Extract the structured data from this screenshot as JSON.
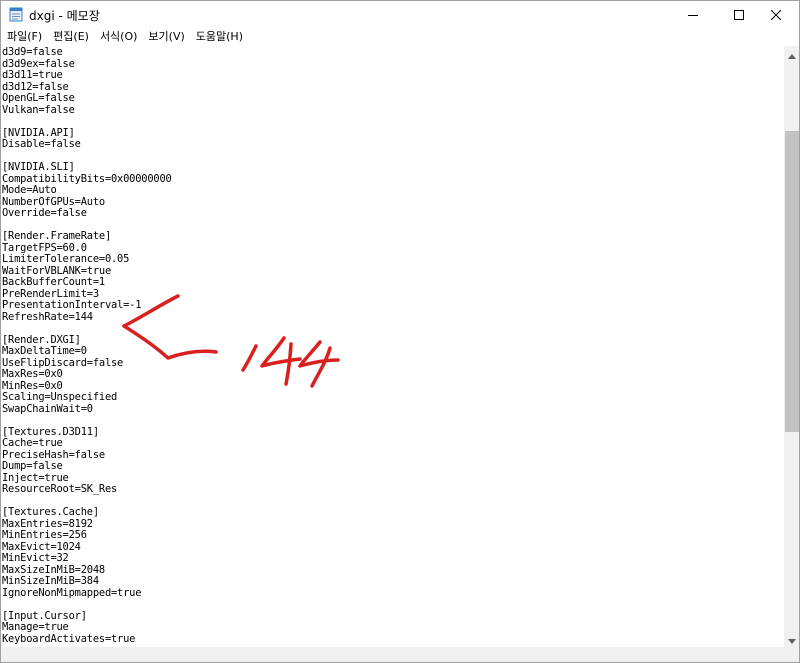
{
  "window": {
    "title": "dxgi - 메모장",
    "icons": {
      "app": "notepad-icon",
      "minimize": "minimize-icon",
      "maximize": "maximize-icon",
      "close": "close-icon"
    }
  },
  "menu": [
    {
      "label": "파일(F)"
    },
    {
      "label": "편집(E)"
    },
    {
      "label": "서식(O)"
    },
    {
      "label": "보기(V)"
    },
    {
      "label": "도움말(H)"
    }
  ],
  "editor": {
    "lines": [
      "d3d9=false",
      "d3d9ex=false",
      "d3d11=true",
      "d3d12=false",
      "OpenGL=false",
      "Vulkan=false",
      "",
      "[NVIDIA.API]",
      "Disable=false",
      "",
      "[NVIDIA.SLI]",
      "CompatibilityBits=0x00000000",
      "Mode=Auto",
      "NumberOfGPUs=Auto",
      "Override=false",
      "",
      "[Render.FrameRate]",
      "TargetFPS=60.0",
      "LimiterTolerance=0.05",
      "WaitForVBLANK=true",
      "BackBufferCount=1",
      "PreRenderLimit=3",
      "PresentationInterval=-1",
      "RefreshRate=144",
      "",
      "[Render.DXGI]",
      "MaxDeltaTime=0",
      "UseFlipDiscard=false",
      "MaxRes=0x0",
      "MinRes=0x0",
      "Scaling=Unspecified",
      "SwapChainWait=0",
      "",
      "[Textures.D3D11]",
      "Cache=true",
      "PreciseHash=false",
      "Dump=false",
      "Inject=true",
      "ResourceRoot=SK_Res",
      "",
      "[Textures.Cache]",
      "MaxEntries=8192",
      "MinEntries=256",
      "MaxEvict=1024",
      "MinEvict=32",
      "MaxSizeInMiB=2048",
      "MinSizeInMiB=384",
      "IgnoreNonMipmapped=true",
      "",
      "[Input.Cursor]",
      "Manage=true",
      "KeyboardActivates=true"
    ]
  },
  "scrollbar": {
    "vertical_thumb_start": 0.12,
    "vertical_thumb_end": 0.65
  },
  "annotation": {
    "handwritten_text": "144",
    "color": "#d9201f"
  }
}
